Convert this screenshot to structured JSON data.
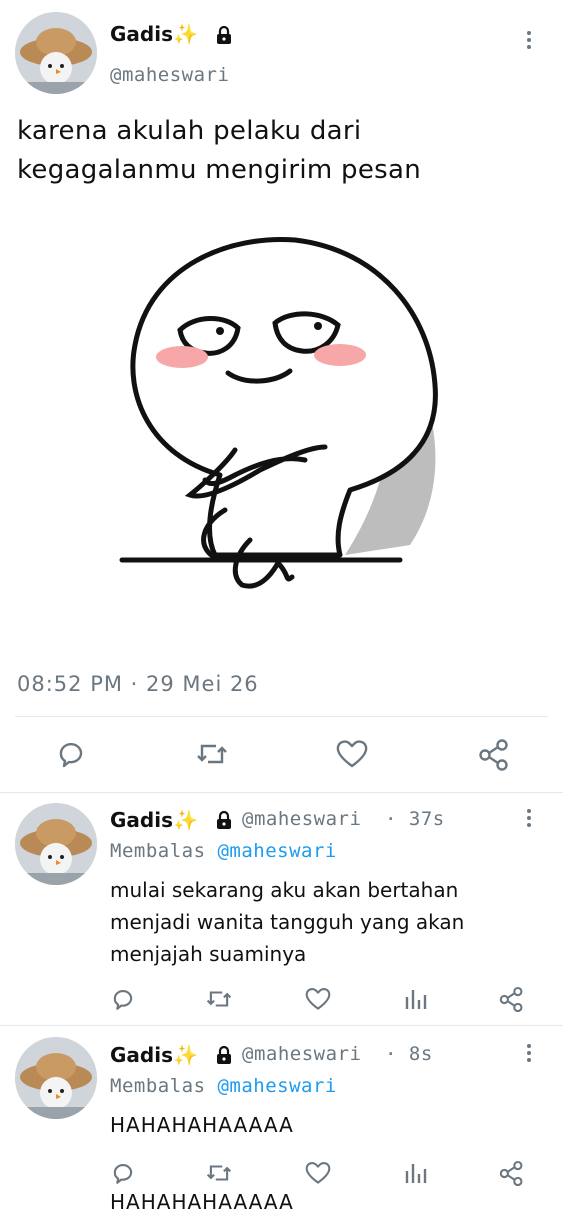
{
  "tweet": {
    "display_name": "Gadis",
    "name_emoji": "✨",
    "handle": "@maheswari",
    "text_line1": "karena akulah pelaku dari",
    "text_line2": "kegagalanmu mengirim pesan",
    "timestamp": "08:52 PM · 29 Mei 26"
  },
  "replies": [
    {
      "display_name": "Gadis",
      "name_emoji": "✨",
      "handle": "@maheswari",
      "time": "· 37s",
      "replying_prefix": "Membalas",
      "replying_to": "@maheswari",
      "line1": "mulai sekarang aku akan bertahan",
      "line2": "menjadi wanita tangguh yang akan",
      "line3": "menjajah suaminya"
    },
    {
      "display_name": "Gadis",
      "name_emoji": "✨",
      "handle": "@maheswari",
      "time": "· 8s",
      "replying_prefix": "Membalas",
      "replying_to": "@maheswari",
      "line1": "HAHAHAHAAAAA",
      "line_cut": "HAHAHAHAAAAA"
    }
  ],
  "icons": {
    "lock": "lock-icon",
    "more": "more-vertical-icon",
    "reply": "reply-icon",
    "retweet": "retweet-icon",
    "like": "heart-icon",
    "share": "share-icon",
    "stats": "stats-icon"
  },
  "colors": {
    "accent": "#1d9bf0",
    "muted": "#6b7780",
    "cheek": "#f7a7a8"
  }
}
